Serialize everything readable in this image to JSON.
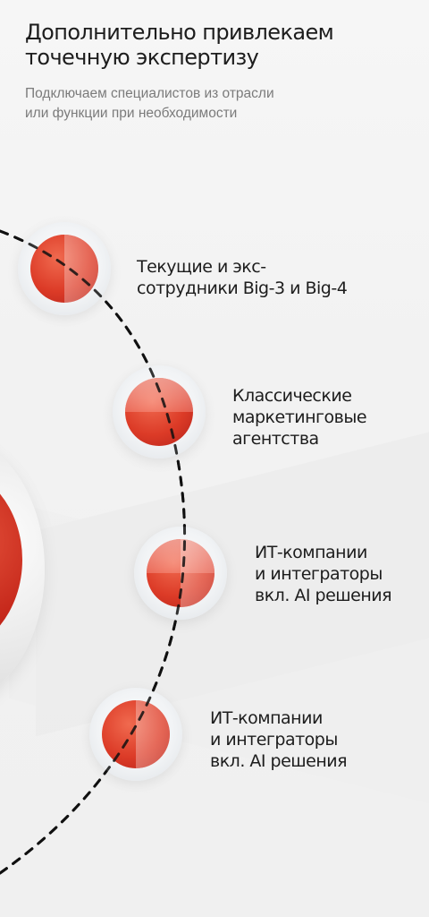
{
  "header": {
    "title": "Дополнительно привлекаем\nточечную экспертизу",
    "subtitle": "Подключаем специалистов из отрасли\nили функции при необходимости"
  },
  "items": [
    {
      "label": "Текущие и экс-\nсотрудники Big-3 и Big-4"
    },
    {
      "label": "Классические\nмаркетинговые\nагентства"
    },
    {
      "label": "ИТ-компании\nи интеграторы\nвкл. AI решения"
    },
    {
      "label": "ИТ-компании\nи интеграторы\nвкл. AI решения"
    }
  ],
  "colors": {
    "accent": "#dc3b27",
    "text": "#1d1d1d",
    "muted": "#7b7b7b"
  }
}
